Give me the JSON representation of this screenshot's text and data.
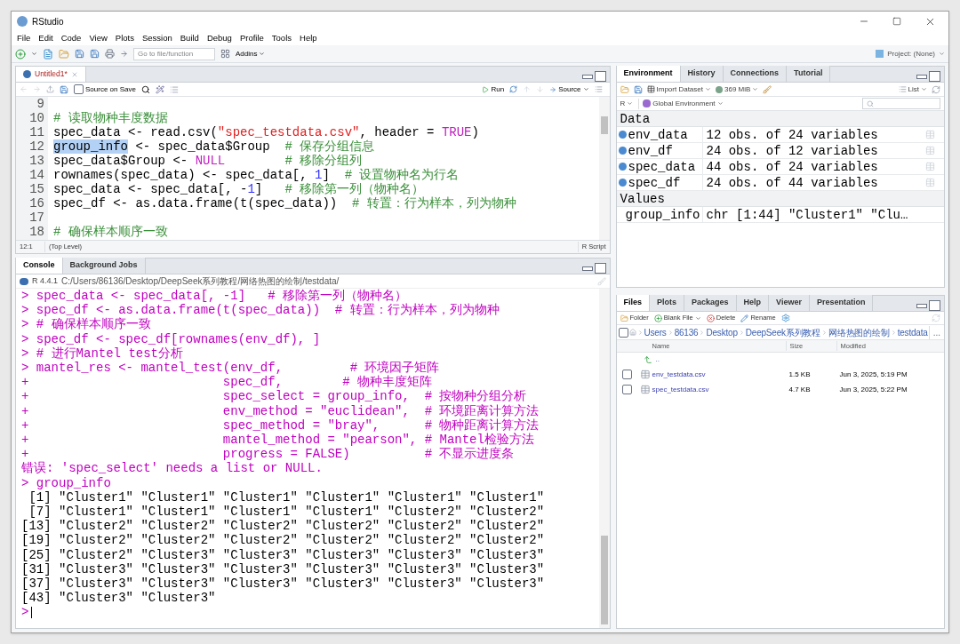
{
  "window": {
    "title": "RStudio"
  },
  "menu": [
    "File",
    "Edit",
    "Code",
    "View",
    "Plots",
    "Session",
    "Build",
    "Debug",
    "Profile",
    "Tools",
    "Help"
  ],
  "toolbar": {
    "search_placeholder": "Go to file/function",
    "addins": "Addins",
    "project": "Project: (None)"
  },
  "editor": {
    "tabs": [
      {
        "label": "Untitled1*",
        "selected": true
      }
    ],
    "source_on_save": {
      "label": "Source on Save",
      "checked": false
    },
    "run": "Run",
    "source": "Source",
    "lines": [
      {
        "n": "9"
      },
      {
        "n": "10",
        "tokens": [
          {
            "kind": "comment",
            "t": "# 读取物种丰度数据"
          }
        ]
      },
      {
        "n": "11",
        "tokens": [
          {
            "kind": "plain",
            "t": "spec_data <- read.csv("
          },
          {
            "kind": "string",
            "t": "\"spec_testdata.csv\""
          },
          {
            "kind": "plain",
            "t": ", header = "
          },
          {
            "kind": "keyword",
            "t": "TRUE"
          },
          {
            "kind": "plain",
            "t": ")"
          }
        ]
      },
      {
        "n": "12",
        "tokens": [
          {
            "kind": "selection",
            "t": "group_info"
          },
          {
            "kind": "plain",
            "t": " <- spec_data$Group  "
          },
          {
            "kind": "comment",
            "t": "# 保存分组信息"
          }
        ]
      },
      {
        "n": "13",
        "tokens": [
          {
            "kind": "plain",
            "t": "spec_data$Group <- "
          },
          {
            "kind": "keyword",
            "t": "NULL"
          },
          {
            "kind": "comment",
            "t": "        # 移除分组列"
          }
        ]
      },
      {
        "n": "14",
        "tokens": [
          {
            "kind": "plain",
            "t": "rownames(spec_data) <- spec_data[, "
          },
          {
            "kind": "number",
            "t": "1"
          },
          {
            "kind": "plain",
            "t": "]  "
          },
          {
            "kind": "comment",
            "t": "# 设置物种名为行名"
          }
        ]
      },
      {
        "n": "15",
        "tokens": [
          {
            "kind": "plain",
            "t": "spec_data <- spec_data[, -"
          },
          {
            "kind": "number",
            "t": "1"
          },
          {
            "kind": "plain",
            "t": "]   "
          },
          {
            "kind": "comment",
            "t": "# 移除第一列（物种名）"
          }
        ]
      },
      {
        "n": "16",
        "tokens": [
          {
            "kind": "plain",
            "t": "spec_df <- as.data.frame(t(spec_data))  "
          },
          {
            "kind": "comment",
            "t": "# 转置：行为样本，列为物种"
          }
        ]
      },
      {
        "n": "17"
      },
      {
        "n": "18",
        "tokens": [
          {
            "kind": "comment",
            "t": "# 确保样本顺序一致"
          }
        ]
      }
    ],
    "status": {
      "position": "12:1",
      "scope": "(Top Level)",
      "filetype": "R Script"
    }
  },
  "console": {
    "tabs": [
      {
        "label": "Console",
        "selected": true
      },
      {
        "label": "Background Jobs",
        "selected": false
      }
    ],
    "version": "R 4.4.1",
    "path": "C:/Users/86136/Desktop/DeepSeek系列教程/网络热图的绘制/testdata/",
    "lines": [
      {
        "kind": "input",
        "text": "> spec_data <- spec_data[, -1]   # 移除第一列（物种名）"
      },
      {
        "kind": "input",
        "text": "> spec_df <- as.data.frame(t(spec_data))  # 转置：行为样本，列为物种"
      },
      {
        "kind": "input",
        "text": "> # 确保样本顺序一致"
      },
      {
        "kind": "input",
        "text": "> spec_df <- spec_df[rownames(env_df), ]"
      },
      {
        "kind": "input",
        "text": "> # 进行Mantel test分析"
      },
      {
        "kind": "input",
        "text": "> mantel_res <- mantel_test(env_df,         # 环境因子矩阵"
      },
      {
        "kind": "input",
        "text": "+                          spec_df,        # 物种丰度矩阵"
      },
      {
        "kind": "input",
        "text": "+                          spec_select = group_info,  # 按物种分组分析"
      },
      {
        "kind": "input",
        "text": "+                          env_method = \"euclidean\",  # 环境距离计算方法"
      },
      {
        "kind": "input",
        "text": "+                          spec_method = \"bray\",      # 物种距离计算方法"
      },
      {
        "kind": "input",
        "text": "+                          mantel_method = \"pearson\", # Mantel检验方法"
      },
      {
        "kind": "input",
        "text": "+                          progress = FALSE)          # 不显示进度条"
      },
      {
        "kind": "input",
        "text": "错误: 'spec_select' needs a list or NULL."
      },
      {
        "kind": "input",
        "text": "> group_info"
      },
      {
        "kind": "output",
        "text": " [1] \"Cluster1\" \"Cluster1\" \"Cluster1\" \"Cluster1\" \"Cluster1\" \"Cluster1\""
      },
      {
        "kind": "output",
        "text": " [7] \"Cluster1\" \"Cluster1\" \"Cluster1\" \"Cluster1\" \"Cluster2\" \"Cluster2\""
      },
      {
        "kind": "output",
        "text": "[13] \"Cluster2\" \"Cluster2\" \"Cluster2\" \"Cluster2\" \"Cluster2\" \"Cluster2\""
      },
      {
        "kind": "output",
        "text": "[19] \"Cluster2\" \"Cluster2\" \"Cluster2\" \"Cluster2\" \"Cluster2\" \"Cluster2\""
      },
      {
        "kind": "output",
        "text": "[25] \"Cluster2\" \"Cluster3\" \"Cluster3\" \"Cluster3\" \"Cluster3\" \"Cluster3\""
      },
      {
        "kind": "output",
        "text": "[31] \"Cluster3\" \"Cluster3\" \"Cluster3\" \"Cluster3\" \"Cluster3\" \"Cluster3\""
      },
      {
        "kind": "output",
        "text": "[37] \"Cluster3\" \"Cluster3\" \"Cluster3\" \"Cluster3\" \"Cluster3\" \"Cluster3\""
      },
      {
        "kind": "output",
        "text": "[43] \"Cluster3\" \"Cluster3\""
      }
    ],
    "prompt": ">"
  },
  "environment": {
    "tabs": [
      {
        "label": "Environment",
        "selected": true
      },
      {
        "label": "History",
        "selected": false
      },
      {
        "label": "Connections",
        "selected": false
      },
      {
        "label": "Tutorial",
        "selected": false
      }
    ],
    "import": "Import Dataset",
    "memory": "369 MiB",
    "view": "List",
    "language": "R",
    "scope": "Global Environment",
    "sections": [
      {
        "title": "Data",
        "rows": [
          {
            "kind": "data",
            "name": "env_data",
            "value": "12 obs. of 24 variables"
          },
          {
            "kind": "data",
            "name": "env_df",
            "value": "24 obs. of 12 variables"
          },
          {
            "kind": "data",
            "name": "spec_data",
            "value": "44 obs. of 24 variables"
          },
          {
            "kind": "data",
            "name": "spec_df",
            "value": "24 obs. of 44 variables"
          }
        ]
      },
      {
        "title": "Values",
        "rows": [
          {
            "kind": "value",
            "name": "group_info",
            "value": "chr [1:44] \"Cluster1\" \"Clu…"
          }
        ]
      }
    ]
  },
  "files": {
    "tabs": [
      {
        "label": "Files",
        "selected": true
      },
      {
        "label": "Plots",
        "selected": false
      },
      {
        "label": "Packages",
        "selected": false
      },
      {
        "label": "Help",
        "selected": false
      },
      {
        "label": "Viewer",
        "selected": false
      },
      {
        "label": "Presentation",
        "selected": false
      }
    ],
    "actions": {
      "folder": "Folder",
      "blank_file": "Blank File",
      "delete": "Delete",
      "rename": "Rename"
    },
    "breadcrumb": [
      "Users",
      "86136",
      "Desktop",
      "DeepSeek系列教程",
      "网络热图的绘制",
      "testdata"
    ],
    "more": "...",
    "select_all_checked": false,
    "columns": [
      "Name",
      "Size",
      "Modified"
    ],
    "parent": "..",
    "rows": [
      {
        "name": "env_testdata.csv",
        "size": "1.5 KB",
        "modified": "Jun 3, 2025, 5:19 PM",
        "checked": false
      },
      {
        "name": "spec_testdata.csv",
        "size": "4.7 KB",
        "modified": "Jun 3, 2025, 5:22 PM",
        "checked": false
      }
    ]
  }
}
